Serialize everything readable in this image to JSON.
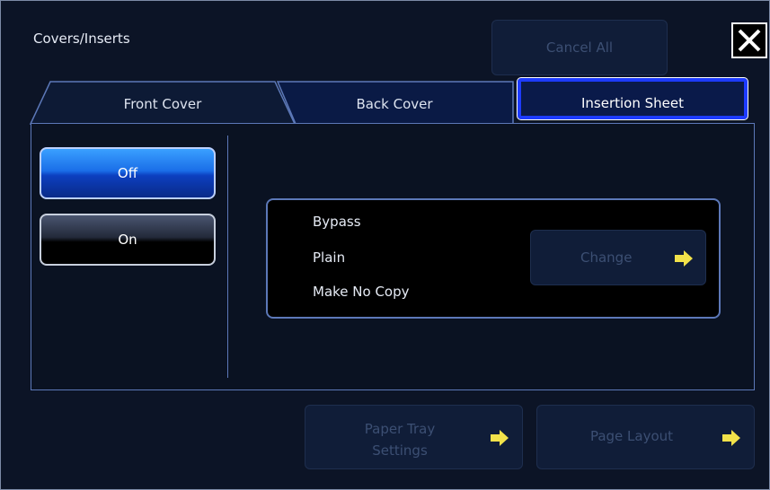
{
  "window": {
    "title": "Covers/Inserts"
  },
  "header": {
    "cancel_all_label": "Cancel All"
  },
  "tabs": [
    {
      "label": "Front Cover"
    },
    {
      "label": "Back Cover"
    },
    {
      "label": "Insertion Sheet"
    }
  ],
  "toggle": {
    "off_label": "Off",
    "on_label": "On",
    "selected": "Off"
  },
  "settings": {
    "lines": [
      "Bypass",
      "Plain",
      "Make No Copy"
    ],
    "change_label": "Change"
  },
  "footer": {
    "paper_tray_label_line1": "Paper Tray",
    "paper_tray_label_line2": "Settings",
    "page_layout_label": "Page Layout"
  },
  "colors": {
    "background": "#0c1426",
    "accent_blue": "#1d3bff",
    "arrow_yellow": "#f2e24a"
  }
}
